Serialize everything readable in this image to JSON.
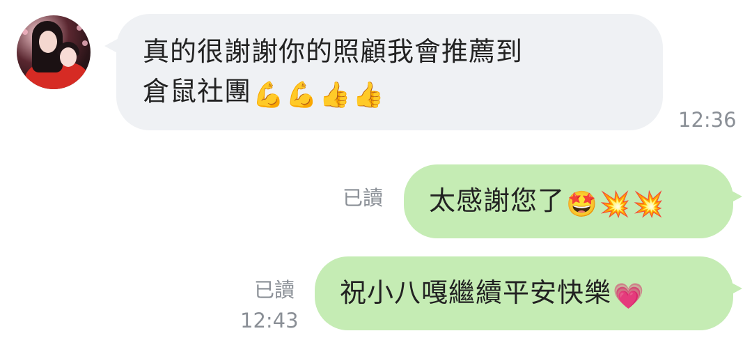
{
  "messages": {
    "incoming": {
      "line1": "真的很謝謝你的照顧我會推薦到",
      "line2": "倉鼠社團",
      "emojis": [
        "💪",
        "💪",
        "👍",
        "👍"
      ],
      "time": "12:36"
    },
    "outgoing1": {
      "text": "太感謝您了",
      "emojis": [
        "🤩",
        "💥",
        "💥"
      ],
      "status": "已讀"
    },
    "outgoing2": {
      "text": "祝小八嘎繼續平安快樂",
      "emojis": [
        "💗"
      ],
      "status": "已讀",
      "time": "12:43"
    }
  },
  "colors": {
    "incoming_bubble": "#eff1f4",
    "outgoing_bubble": "#c5ecb4",
    "meta_text": "#8a8f96"
  }
}
